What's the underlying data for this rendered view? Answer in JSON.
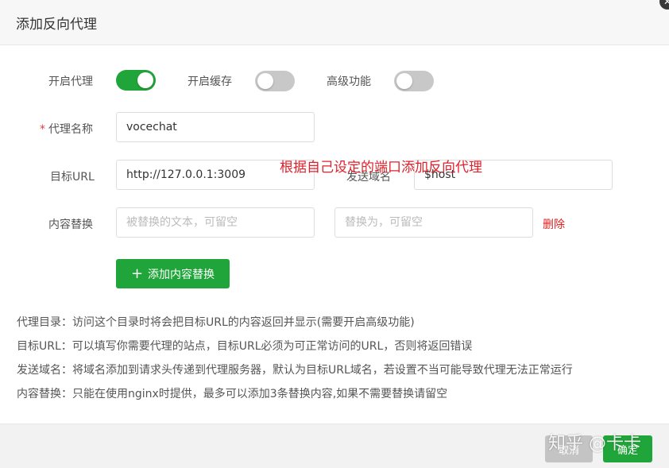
{
  "dialog": {
    "title": "添加反向代理",
    "close_icon": "close-icon"
  },
  "toggles": {
    "proxy_enable": {
      "label": "开启代理",
      "on": true
    },
    "cache_enable": {
      "label": "开启缓存",
      "on": false
    },
    "advanced": {
      "label": "高级功能",
      "on": false
    }
  },
  "form": {
    "proxy_name": {
      "label": "代理名称",
      "required_mark": "*",
      "value": "vocechat"
    },
    "target_url": {
      "label": "目标URL",
      "value": "http://127.0.0.1:3009"
    },
    "send_domain": {
      "label": "发送域名",
      "value": "$host"
    },
    "content_replace": {
      "label": "内容替换",
      "from_placeholder": "被替换的文本，可留空",
      "to_placeholder": "替换为，可留空",
      "delete_label": "删除"
    },
    "add_replace_label": "添加内容替换"
  },
  "annotation": "根据自己设定的端口添加反向代理",
  "help": [
    "代理目录：访问这个目录时将会把目标URL的内容返回并显示(需要开启高级功能)",
    "目标URL：可以填写你需要代理的站点，目标URL必须为可正常访问的URL，否则将返回错误",
    "发送域名：将域名添加到请求头传递到代理服务器，默认为目标URL域名，若设置不当可能导致代理无法正常运行",
    "内容替换：只能在使用nginx时提供，最多可以添加3条替换内容,如果不需要替换请留空"
  ],
  "footer": {
    "cancel_label": "取消",
    "confirm_label": "确定"
  },
  "watermark": "知乎 @卡卡",
  "colors": {
    "accent": "#20a53a",
    "danger": "#e02020",
    "toggle_off": "#c8c8c8"
  }
}
